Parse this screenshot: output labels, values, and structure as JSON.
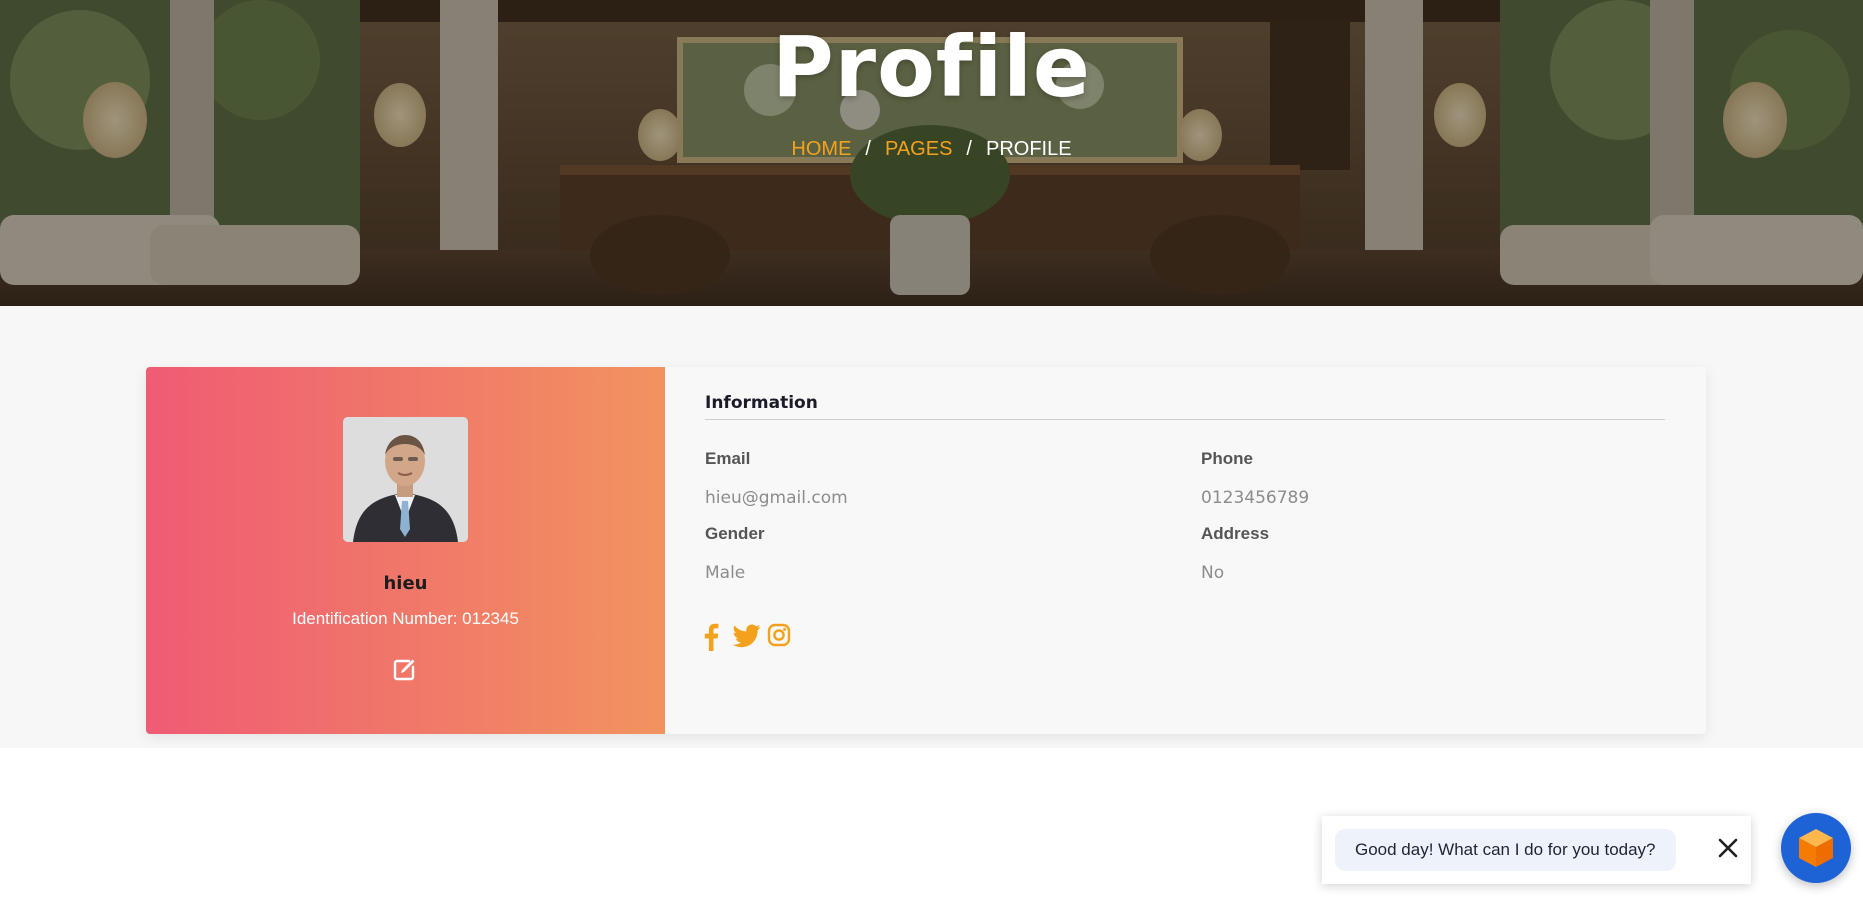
{
  "hero": {
    "title": "Profile",
    "breadcrumb": {
      "home": "HOME",
      "sep1": "/",
      "pages": "PAGES",
      "sep2": "/",
      "current": "PROFILE"
    }
  },
  "profile": {
    "name": "hieu",
    "identification": "Identification Number: 012345",
    "edit_icon": "edit-icon"
  },
  "info": {
    "title": "Information",
    "fields": [
      {
        "label": "Email",
        "value": "hieu@gmail.com"
      },
      {
        "label": "Phone",
        "value": "0123456789"
      },
      {
        "label": "Gender",
        "value": "Male"
      },
      {
        "label": "Address",
        "value": "No"
      }
    ],
    "social": [
      "facebook-icon",
      "twitter-icon",
      "instagram-icon"
    ]
  },
  "chat": {
    "message": "Good day! What can I do for you today?",
    "close_icon": "close-icon",
    "launcher_icon": "cube-icon"
  },
  "colors": {
    "accent": "#f4a21e",
    "gradient_start": "#ef5b74",
    "gradient_end": "#f2935f",
    "chat_launcher": "#1d63d6"
  }
}
